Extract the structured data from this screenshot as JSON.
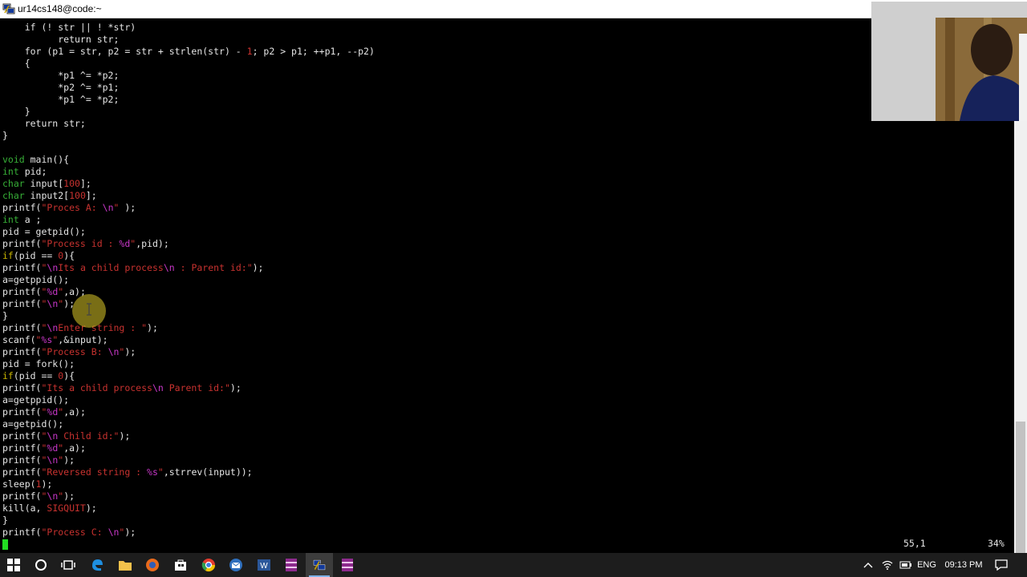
{
  "window": {
    "title": "ur14cs148@code:~"
  },
  "editor": {
    "lines": [
      [
        [
          "    if (! str || ! *str)",
          "t-norm"
        ]
      ],
      [
        [
          "          return str;",
          "t-norm"
        ]
      ],
      [
        [
          "    for (p1 = str, p2 = str + strlen(str) - ",
          "t-norm"
        ],
        [
          "1",
          "t-num"
        ],
        [
          "; p2 > p1; ++p1, --p2)",
          "t-norm"
        ]
      ],
      [
        [
          "    {",
          "t-norm"
        ]
      ],
      [
        [
          "          *p1 ^= *p2;",
          "t-norm"
        ]
      ],
      [
        [
          "          *p2 ^= *p1;",
          "t-norm"
        ]
      ],
      [
        [
          "          *p1 ^= *p2;",
          "t-norm"
        ]
      ],
      [
        [
          "    }",
          "t-norm"
        ]
      ],
      [
        [
          "    return str;",
          "t-norm"
        ]
      ],
      [
        [
          "}",
          "t-norm"
        ]
      ],
      [
        [
          "",
          "t-norm"
        ]
      ],
      [
        [
          "void",
          "t-type"
        ],
        [
          " main(){",
          "t-norm"
        ]
      ],
      [
        [
          "int",
          "t-type"
        ],
        [
          " pid;",
          "t-norm"
        ]
      ],
      [
        [
          "char",
          "t-type"
        ],
        [
          " input[",
          "t-norm"
        ],
        [
          "100",
          "t-num"
        ],
        [
          "];",
          "t-norm"
        ]
      ],
      [
        [
          "char",
          "t-type"
        ],
        [
          " input2[",
          "t-norm"
        ],
        [
          "100",
          "t-num"
        ],
        [
          "];",
          "t-norm"
        ]
      ],
      [
        [
          "printf(",
          "t-norm"
        ],
        [
          "\"Proces A: ",
          "t-str"
        ],
        [
          "\\n",
          "t-esc"
        ],
        [
          "\"",
          "t-str"
        ],
        [
          " );",
          "t-norm"
        ]
      ],
      [
        [
          "int",
          "t-type"
        ],
        [
          " a ;",
          "t-norm"
        ]
      ],
      [
        [
          "pid = getpid();",
          "t-norm"
        ]
      ],
      [
        [
          "printf(",
          "t-norm"
        ],
        [
          "\"Process id : ",
          "t-str"
        ],
        [
          "%d",
          "t-esc"
        ],
        [
          "\"",
          "t-str"
        ],
        [
          ",pid);",
          "t-norm"
        ]
      ],
      [
        [
          "if",
          "t-kw"
        ],
        [
          "(pid == ",
          "t-norm"
        ],
        [
          "0",
          "t-num"
        ],
        [
          "){",
          "t-norm"
        ]
      ],
      [
        [
          "printf(",
          "t-norm"
        ],
        [
          "\"",
          "t-str"
        ],
        [
          "\\n",
          "t-esc"
        ],
        [
          "Its a child process",
          "t-str"
        ],
        [
          "\\n",
          "t-esc"
        ],
        [
          " : Parent id:\"",
          "t-str"
        ],
        [
          ");",
          "t-norm"
        ]
      ],
      [
        [
          "a=getppid();",
          "t-norm"
        ]
      ],
      [
        [
          "printf(",
          "t-norm"
        ],
        [
          "\"",
          "t-str"
        ],
        [
          "%d",
          "t-esc"
        ],
        [
          "\"",
          "t-str"
        ],
        [
          ",a);",
          "t-norm"
        ]
      ],
      [
        [
          "printf(",
          "t-norm"
        ],
        [
          "\"",
          "t-str"
        ],
        [
          "\\n",
          "t-esc"
        ],
        [
          "\"",
          "t-str"
        ],
        [
          ");",
          "t-norm"
        ]
      ],
      [
        [
          "}",
          "t-norm"
        ]
      ],
      [
        [
          "printf(",
          "t-norm"
        ],
        [
          "\"",
          "t-str"
        ],
        [
          "\\n",
          "t-esc"
        ],
        [
          "Enter string : \"",
          "t-str"
        ],
        [
          ");",
          "t-norm"
        ]
      ],
      [
        [
          "scanf(",
          "t-norm"
        ],
        [
          "\"",
          "t-str"
        ],
        [
          "%s",
          "t-esc"
        ],
        [
          "\"",
          "t-str"
        ],
        [
          ",&input);",
          "t-norm"
        ]
      ],
      [
        [
          "printf(",
          "t-norm"
        ],
        [
          "\"Process B: ",
          "t-str"
        ],
        [
          "\\n",
          "t-esc"
        ],
        [
          "\"",
          "t-str"
        ],
        [
          ");",
          "t-norm"
        ]
      ],
      [
        [
          "pid = fork();",
          "t-norm"
        ]
      ],
      [
        [
          "if",
          "t-kw"
        ],
        [
          "(pid == ",
          "t-norm"
        ],
        [
          "0",
          "t-num"
        ],
        [
          "){",
          "t-norm"
        ]
      ],
      [
        [
          "printf(",
          "t-norm"
        ],
        [
          "\"Its a child process",
          "t-str"
        ],
        [
          "\\n",
          "t-esc"
        ],
        [
          " Parent id:\"",
          "t-str"
        ],
        [
          ");",
          "t-norm"
        ]
      ],
      [
        [
          "a=getppid();",
          "t-norm"
        ]
      ],
      [
        [
          "printf(",
          "t-norm"
        ],
        [
          "\"",
          "t-str"
        ],
        [
          "%d",
          "t-esc"
        ],
        [
          "\"",
          "t-str"
        ],
        [
          ",a);",
          "t-norm"
        ]
      ],
      [
        [
          "a=getpid();",
          "t-norm"
        ]
      ],
      [
        [
          "printf(",
          "t-norm"
        ],
        [
          "\"",
          "t-str"
        ],
        [
          "\\n",
          "t-esc"
        ],
        [
          " Child id:\"",
          "t-str"
        ],
        [
          ");",
          "t-norm"
        ]
      ],
      [
        [
          "printf(",
          "t-norm"
        ],
        [
          "\"",
          "t-str"
        ],
        [
          "%d",
          "t-esc"
        ],
        [
          "\"",
          "t-str"
        ],
        [
          ",a);",
          "t-norm"
        ]
      ],
      [
        [
          "printf(",
          "t-norm"
        ],
        [
          "\"",
          "t-str"
        ],
        [
          "\\n",
          "t-esc"
        ],
        [
          "\"",
          "t-str"
        ],
        [
          ");",
          "t-norm"
        ]
      ],
      [
        [
          "printf(",
          "t-norm"
        ],
        [
          "\"Reversed string : ",
          "t-str"
        ],
        [
          "%s",
          "t-esc"
        ],
        [
          "\"",
          "t-str"
        ],
        [
          ",strrev(input));",
          "t-norm"
        ]
      ],
      [
        [
          "sleep(",
          "t-norm"
        ],
        [
          "1",
          "t-num"
        ],
        [
          ");",
          "t-norm"
        ]
      ],
      [
        [
          "printf(",
          "t-norm"
        ],
        [
          "\"",
          "t-str"
        ],
        [
          "\\n",
          "t-esc"
        ],
        [
          "\"",
          "t-str"
        ],
        [
          ");",
          "t-norm"
        ]
      ],
      [
        [
          "kill(a, ",
          "t-norm"
        ],
        [
          "SIGQUIT",
          "t-str"
        ],
        [
          ");",
          "t-norm"
        ]
      ],
      [
        [
          "}",
          "t-norm"
        ]
      ],
      [
        [
          "printf(",
          "t-norm"
        ],
        [
          "\"Process C: ",
          "t-str"
        ],
        [
          "\\n",
          "t-esc"
        ],
        [
          "\"",
          "t-str"
        ],
        [
          ");",
          "t-norm"
        ]
      ]
    ],
    "cursor_line": 43,
    "status": {
      "position": "55,1",
      "percent": "34%"
    },
    "scroll_fraction": 0.34
  },
  "taskbar": {
    "apps": [
      {
        "name": "start-button",
        "icon": "windows-logo-icon"
      },
      {
        "name": "search-button",
        "icon": "search-circle-icon"
      },
      {
        "name": "task-view-button",
        "icon": "task-view-icon"
      },
      {
        "name": "edge-app",
        "icon": "edge-icon"
      },
      {
        "name": "file-explorer-app",
        "icon": "folder-icon"
      },
      {
        "name": "firefox-app",
        "icon": "firefox-icon"
      },
      {
        "name": "store-app",
        "icon": "store-icon"
      },
      {
        "name": "chrome-app",
        "icon": "chrome-icon"
      },
      {
        "name": "thunderbird-app",
        "icon": "thunderbird-icon"
      },
      {
        "name": "word-app",
        "icon": "word-icon"
      },
      {
        "name": "winrar-app",
        "icon": "winrar-icon"
      },
      {
        "name": "putty-app",
        "icon": "putty-icon",
        "active": true
      },
      {
        "name": "winrar-app-2",
        "icon": "winrar-icon"
      }
    ],
    "tray": {
      "language": "ENG",
      "time": "09:13 PM"
    }
  },
  "colors": {
    "taskbar": "#1d1d1d",
    "keyword": "#c8b400",
    "type": "#37b037",
    "string": "#c8322f",
    "escape": "#c837c8",
    "cursor": "#22dd22"
  }
}
